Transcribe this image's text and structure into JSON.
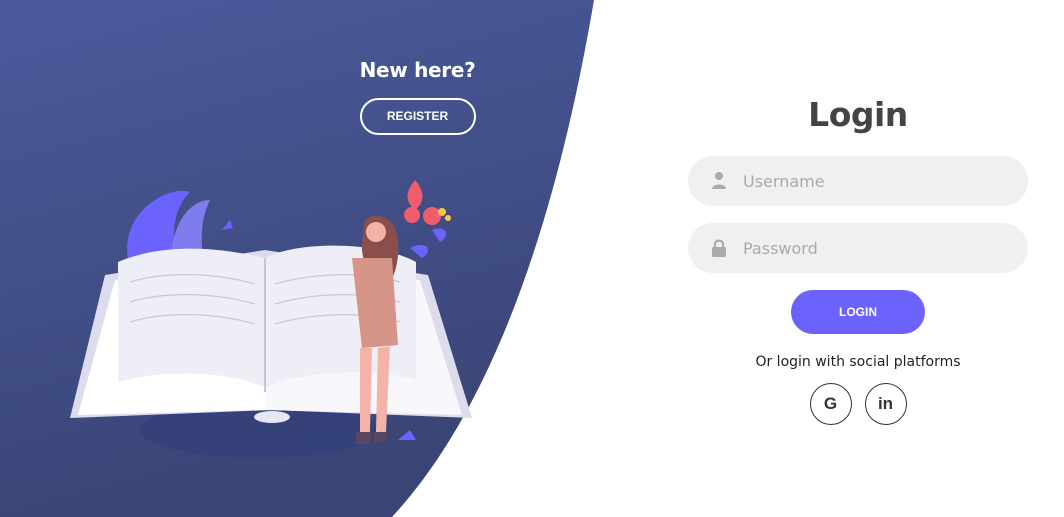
{
  "left_panel": {
    "heading": "New here?",
    "register_label": "REGISTER"
  },
  "login_form": {
    "title": "Login",
    "username_placeholder": "Username",
    "password_placeholder": "Password",
    "login_label": "LOGIN",
    "social_text": "Or login with social platforms",
    "social": [
      {
        "label": "G",
        "icon": "google-icon"
      },
      {
        "label": "in",
        "icon": "linkedin-icon"
      }
    ]
  },
  "colors": {
    "panel_gradient_top": "#4a5a9c",
    "panel_gradient_bottom": "#3a4575",
    "accent": "#6c63ff",
    "input_bg": "#f0f0f0",
    "title_text": "#444444"
  }
}
